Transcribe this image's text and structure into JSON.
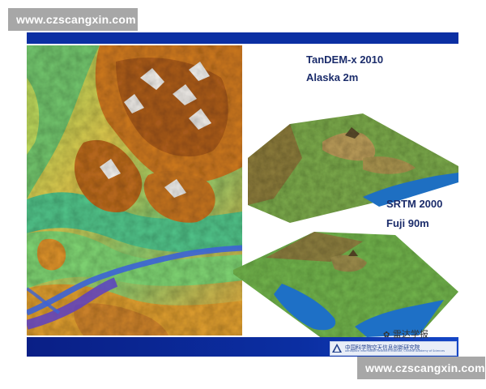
{
  "watermark": {
    "top": "www.czscangxin.com",
    "bottom": "www.czscangxin.com"
  },
  "slide": {
    "tandem_title": "TanDEM-x 2010",
    "tandem_place": "Alaska  2m",
    "srtm_title": "SRTM 2000",
    "srtm_place": "Fuji  90m",
    "wechat_name": "雷达学报",
    "institute_logo": "中国科学院空天信息创新研究院",
    "institute_logo_sub": "Aerospace Information Research Institute, Chinese Academy of Sciences"
  },
  "colors": {
    "banner_blue": "#0b2fa3",
    "title_text": "#1b2c6b",
    "watermark_bg": "#a7a7a7"
  }
}
